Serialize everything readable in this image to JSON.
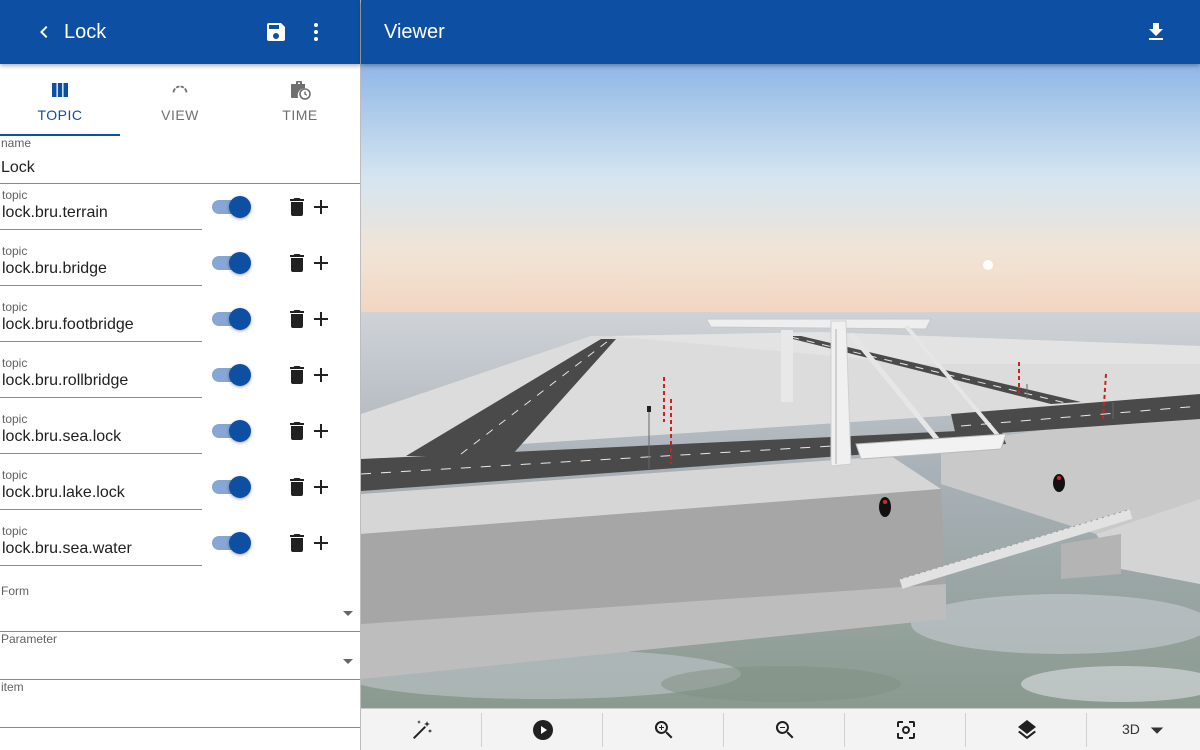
{
  "left_header": {
    "title": "Lock"
  },
  "tabs": [
    {
      "label": "TOPIC",
      "active": true
    },
    {
      "label": "VIEW",
      "active": false
    },
    {
      "label": "TIME",
      "active": false
    }
  ],
  "name_field": {
    "label": "name",
    "value": "Lock"
  },
  "topics": [
    {
      "label": "topic",
      "value": "lock.bru.terrain",
      "enabled": true
    },
    {
      "label": "topic",
      "value": "lock.bru.bridge",
      "enabled": true
    },
    {
      "label": "topic",
      "value": "lock.bru.footbridge",
      "enabled": true
    },
    {
      "label": "topic",
      "value": "lock.bru.rollbridge",
      "enabled": true
    },
    {
      "label": "topic",
      "value": "lock.bru.sea.lock",
      "enabled": true
    },
    {
      "label": "topic",
      "value": "lock.bru.lake.lock",
      "enabled": true
    },
    {
      "label": "topic",
      "value": "lock.bru.sea.water",
      "enabled": true
    }
  ],
  "selects": {
    "form": {
      "label": "Form",
      "value": ""
    },
    "parameter": {
      "label": "Parameter",
      "value": ""
    },
    "item": {
      "label": "item",
      "value": ""
    }
  },
  "viewer": {
    "title": "Viewer",
    "toolbar": [
      "magic-wand-icon",
      "play-icon",
      "zoom-in-icon",
      "zoom-out-icon",
      "center-focus-icon",
      "layers-icon"
    ],
    "mode_label": "3D"
  },
  "colors": {
    "primary": "#0d4fa3",
    "toggle_track": "#86a6d3"
  }
}
